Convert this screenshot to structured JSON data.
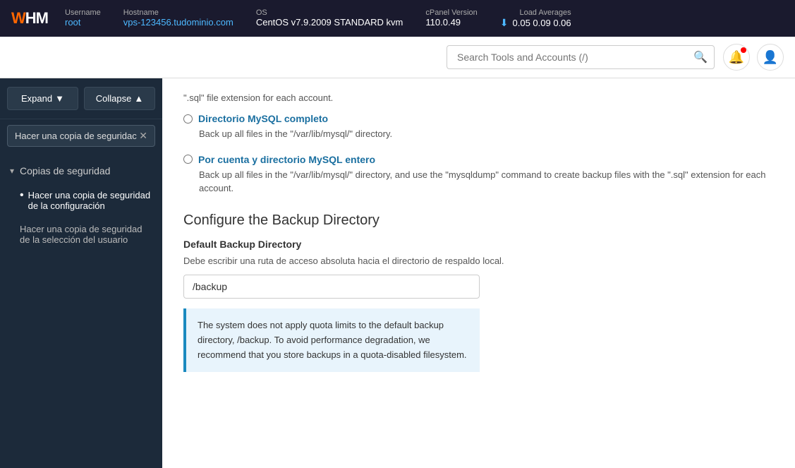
{
  "topbar": {
    "logo": "WHM",
    "username_label": "Username",
    "username_value": "root",
    "hostname_label": "Hostname",
    "hostname_value": "vps-123456.tudominio.com",
    "os_label": "OS",
    "os_value": "CentOS v7.9.2009 STANDARD kvm",
    "cpanel_label": "cPanel Version",
    "cpanel_value": "110.0.49",
    "load_label": "Load Averages",
    "load_values": "0.05  0.09  0.06"
  },
  "searchbar": {
    "placeholder": "Search Tools and Accounts (/)"
  },
  "sidebar": {
    "expand_btn": "Expand",
    "collapse_btn": "Collapse",
    "tag": "Hacer una copia de seguridac",
    "section": "Copias de seguridad",
    "items": [
      "Hacer una copia de seguridad de la configuración",
      "Hacer una copia de seguridad de la selección del usuario"
    ]
  },
  "content": {
    "radio1": {
      "label": "Directorio MySQL completo",
      "desc": "Back up all files in the \"/var/lib/mysql/\" directory."
    },
    "radio2": {
      "label": "Por cuenta y directorio MySQL entero",
      "desc": "Back up all files in the \"/var/lib/mysql/\" directory, and use the \"mysqldump\" command to create backup files with the \".sql\" extension for each account."
    },
    "section_title": "Configure the Backup Directory",
    "field_label": "Default Backup Directory",
    "field_desc": "Debe escribir una ruta de acceso absoluta hacia el directorio de respaldo local.",
    "input_value": "/backup",
    "info_text": "The system does not apply quota limits to the default backup directory, /backup. To avoid performance degradation, we recommend that you store backups in a quota-disabled filesystem.",
    "sql_ext_desc": "\".sql\" file extension for each account."
  }
}
